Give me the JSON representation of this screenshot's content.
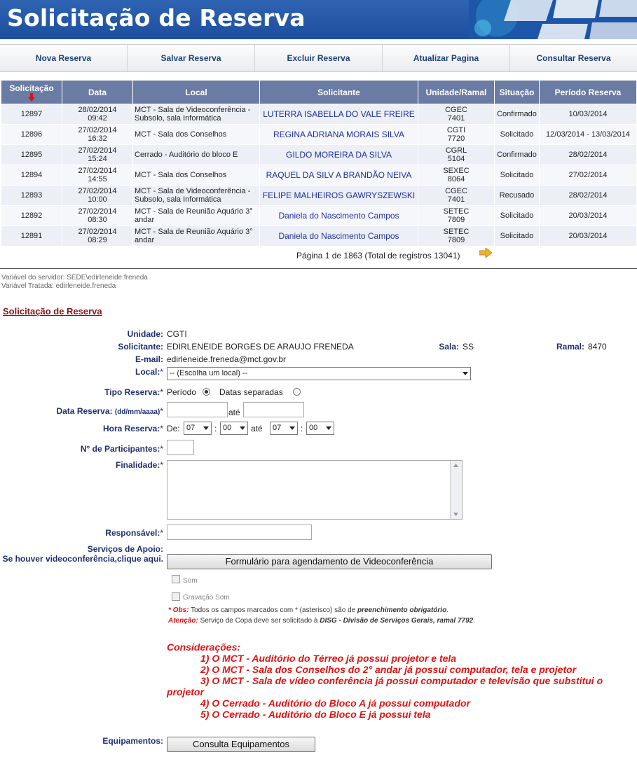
{
  "header": {
    "title": "Solicitação de Reserva"
  },
  "nav": [
    {
      "label": "Nova Reserva"
    },
    {
      "label": "Salvar Reserva"
    },
    {
      "label": "Excluir Reserva"
    },
    {
      "label": "Atualizar Pagina"
    },
    {
      "label": "Consultar Reserva"
    }
  ],
  "table": {
    "columns": [
      "Solicitação",
      "Data",
      "Local",
      "Solicitante",
      "Unidade/Ramal",
      "Situação",
      "Período Reserva"
    ],
    "rows": [
      {
        "id": "12897",
        "date": "28/02/2014",
        "time": "09:42",
        "local": "MCT - Sala de Videoconferência - Subsolo, sala Informática",
        "solicitante": "LUTERRA ISABELLA DO VALE FREIRE",
        "unidade": "CGEC",
        "ramal": "7401",
        "situacao": "Confirmado",
        "periodo": "10/03/2014"
      },
      {
        "id": "12896",
        "date": "27/02/2014",
        "time": "16:32",
        "local": "MCT - Sala dos Conselhos",
        "solicitante": "REGINA ADRIANA MORAIS SILVA",
        "unidade": "CGTI",
        "ramal": "7720",
        "situacao": "Solicitado",
        "periodo": "12/03/2014 - 13/03/2014"
      },
      {
        "id": "12895",
        "date": "27/02/2014",
        "time": "15:24",
        "local": "Cerrado - Auditório do bloco E",
        "solicitante": "GILDO MOREIRA DA SILVA",
        "unidade": "CGRL",
        "ramal": "5104",
        "situacao": "Confirmado",
        "periodo": "28/02/2014"
      },
      {
        "id": "12894",
        "date": "27/02/2014",
        "time": "14:55",
        "local": "MCT - Sala dos Conselhos",
        "solicitante": "RAQUEL DA SILV A BRANDÃO NEIVA",
        "unidade": "SEXEC",
        "ramal": "8064",
        "situacao": "Solicitado",
        "periodo": "27/02/2014"
      },
      {
        "id": "12893",
        "date": "27/02/2014",
        "time": "10:00",
        "local": "MCT - Sala de Videoconferência - Subsolo, sala Informática",
        "solicitante": "FELIPE MALHEIROS GAWRYSZEWSKI",
        "unidade": "CGEC",
        "ramal": "7401",
        "situacao": "Recusado",
        "periodo": "28/02/2014"
      },
      {
        "id": "12892",
        "date": "27/02/2014",
        "time": "08:30",
        "local": "MCT - Sala de Reunião Aquário 3° andar",
        "solicitante": "Daniela do Nascimento Campos",
        "unidade": "SETEC",
        "ramal": "7809",
        "situacao": "Solicitado",
        "periodo": "20/03/2014"
      },
      {
        "id": "12891",
        "date": "27/02/2014",
        "time": "08:29",
        "local": "MCT - Sala de Reunião Aquário 3° andar",
        "solicitante": "Daniela do Nascimento Campos",
        "unidade": "SETEC",
        "ramal": "7809",
        "situacao": "Solicitado",
        "periodo": "20/03/2014"
      }
    ],
    "pager": "Página 1 de 1863 (Total de registros 13041)"
  },
  "server": {
    "var1": "Variável do servidor: SEDE\\edirleneide.freneda",
    "var2": "Variável Tratada: edirleneide.freneda"
  },
  "form": {
    "section_title": "Solicitação de Reserva",
    "unidade_label": "Unidade:",
    "unidade_value": "CGTI",
    "solicitante_label": "Solicitante:",
    "solicitante_value": "EDIRLENEIDE BORGES DE ARAUJO FRENEDA",
    "sala_label": "Sala:",
    "sala_value": "SS",
    "ramal_label": "Ramal:",
    "ramal_value": "8470",
    "email_label": "E-mail:",
    "email_value": "edirleneide.freneda@mct.gov.br",
    "local_label": "Local:",
    "local_value": "-- (Escolha um local) --",
    "tipo_label": "Tipo Reserva:",
    "tipo_periodo": "Período",
    "tipo_datas": "Datas separadas",
    "data_label": "Data Reserva:",
    "data_format": "(dd/mm/aaaa)",
    "ate": "até",
    "hora_label": "Hora Reserva:",
    "de": "De:",
    "colon": ":",
    "hora_ini": "07",
    "min_ini": "00",
    "hora_fim": "07",
    "min_fim": "00",
    "participantes_label": "N° de Participantes:",
    "finalidade_label": "Finalidade:",
    "responsavel_label": "Responsável:",
    "servicos_label": "Serviços de Apoio:",
    "video_hint": "Se houver videoconferência,clique aqui.",
    "video_button": "Formulário para agendamento de Videoconferência",
    "som": "Som",
    "gravacao": "Gravação Som",
    "obs_prefix": "* Obs:",
    "obs_text": "Todos os campos marcados com * (asterisco) são de",
    "obs_bold": "preenchimento obrigatório",
    "atencao_prefix": "Atenção:",
    "atencao_text": "Serviço de Copa deve ser solicitado à",
    "atencao_bold": "DISG - Divisão de Serviços Gerais, ramal 7792",
    "equip_label": "Equipamentos:",
    "equip_button": "Consulta Equipamentos",
    "required_mark": "*"
  },
  "consideracoes": {
    "title": "Considerações:",
    "items": [
      "1) O MCT - Auditório do Térreo já possui projetor e tela",
      "2) O MCT - Sala dos Conselhos do 2° andar já possui computador, tela e projetor",
      "3) O MCT - Sala de vídeo conferência já possui computador e televisão que substitui o",
      "projetor",
      "4) O Cerrado - Auditório do Bloco A já possui computador",
      "5) O Cerrado - Auditório do Bloco E já possui tela"
    ]
  },
  "colors": {
    "header_blue": "#1c4f9e",
    "table_head": "#6a7ba4",
    "link_blue": "#1c2f9e",
    "section_red": "#8b1414",
    "alert_red": "#e11414"
  }
}
